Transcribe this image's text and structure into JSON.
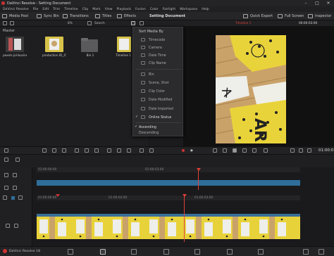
{
  "window": {
    "title": "DaVinci Resolve - Setting Document",
    "controls": [
      "–",
      "□",
      "✕"
    ]
  },
  "menubar": [
    "DaVinci Resolve",
    "File",
    "Edit",
    "Trim",
    "Timeline",
    "Clip",
    "Mark",
    "View",
    "Playback",
    "Fusion",
    "Color",
    "Fairlight",
    "Workspace",
    "Help"
  ],
  "toolbar": {
    "media_pool": "Media Pool",
    "sync_bin": "Sync Bin",
    "transitions": "Transitions",
    "titles": "Titles",
    "effects": "Effects",
    "project_title": "Setting Document",
    "quick_export": "Quick Export",
    "full_screen": "Full Screen",
    "inspector": "Inspector"
  },
  "subbar": {
    "zoom": "8%",
    "search": "Search",
    "timeline_name": "Timeline 1",
    "timecode": "00:00:03:00"
  },
  "media_pool": {
    "bin_label": "Master",
    "clips": [
      {
        "label": "pexels-jol-busines..."
      },
      {
        "label": "production ID_47..."
      },
      {
        "label": "Bin 1"
      },
      {
        "label": "Timeline 1"
      }
    ]
  },
  "sort_menu": {
    "title": "Sort Media By",
    "fields": [
      "Timecode",
      "Camera",
      "Date Time",
      "Clip Name"
    ],
    "metadata": [
      "Bin",
      "Scene, Shot",
      "Clip Color",
      "Date Modified",
      "Date Imported",
      "Online Status"
    ],
    "order": [
      "Ascending",
      "Descending"
    ],
    "checked_field": "Online Status",
    "checked_order": "Ascending"
  },
  "transport": {
    "timecode": "01:00:0"
  },
  "timeline": {
    "upper_ruler": [
      "01:00:00:00",
      "01:00:03:00"
    ],
    "lower_ruler": [
      "01:00:00:00",
      "01:00:02:00",
      "01:00:03:00"
    ],
    "playhead_position": 0.46,
    "clip_fill": 1.0
  },
  "statusbar": {
    "app_name": "DaVinci Resolve 18"
  },
  "colors": {
    "accent_red": "#e0413a",
    "audio_track_blue": "#2f6e9a",
    "video_clip_blue": "#3a6f9a",
    "yellow_clip": "#e8d23a"
  }
}
